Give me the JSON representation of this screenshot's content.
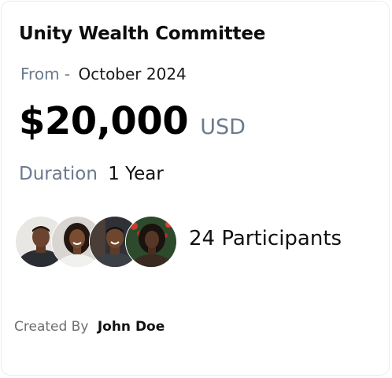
{
  "card": {
    "title": "Unity Wealth Committee",
    "from_label": "From -",
    "from_date": "October 2024",
    "amount": "$20,000",
    "currency": "USD",
    "duration_label": "Duration",
    "duration_value": "1 Year",
    "participants_label": "24 Participants",
    "created_by_label": "Created By",
    "created_by_name": "John Doe"
  },
  "colors": {
    "muted": "#6c7a8e",
    "text": "#111111",
    "card_border": "#ececec"
  },
  "avatars": [
    {
      "icon": "person-avatar-1"
    },
    {
      "icon": "person-avatar-2"
    },
    {
      "icon": "person-avatar-3"
    },
    {
      "icon": "person-avatar-4"
    }
  ]
}
